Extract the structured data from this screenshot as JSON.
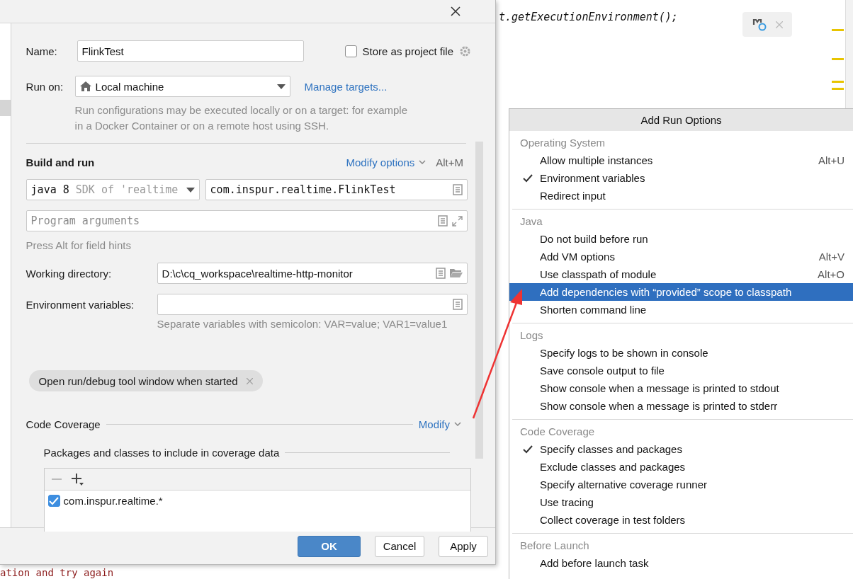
{
  "editor": {
    "code_line": "t.getExecutionEnvironment();",
    "console_line": "ation and try again"
  },
  "dialog": {
    "name": {
      "label": "Name:",
      "value": "FlinkTest"
    },
    "store_as_project_file": {
      "label": "Store as project file",
      "checked": false
    },
    "run_on": {
      "label": "Run on:",
      "value": "Local machine",
      "link": "Manage targets..."
    },
    "run_on_hint": "Run configurations may be executed locally or on a target: for example in a Docker Container or on a remote host using SSH.",
    "build_and_run": {
      "title": "Build and run",
      "modify_link": "Modify options",
      "shortcut": "Alt+M",
      "jdk": {
        "value": "java 8",
        "detail": "SDK of 'realtime"
      },
      "main_class": "com.inspur.realtime.FlinkTest",
      "program_arguments": {
        "placeholder": "Program arguments"
      },
      "field_hint": "Press Alt for field hints"
    },
    "working_directory": {
      "label": "Working directory:",
      "value": "D:\\c\\cq_workspace\\realtime-http-monitor"
    },
    "environment_variables": {
      "label": "Environment variables:",
      "hint": "Separate variables with semicolon: VAR=value; VAR1=value1"
    },
    "option_chip": "Open run/debug tool window when started",
    "code_coverage": {
      "title": "Code Coverage",
      "modify_link": "Modify",
      "include_title": "Packages and classes to include in coverage data",
      "patterns": [
        {
          "label": "com.inspur.realtime.*",
          "checked": true
        }
      ]
    },
    "buttons": [
      {
        "label": "OK",
        "kind": "primary"
      },
      {
        "label": "Cancel",
        "kind": "normal"
      },
      {
        "label": "Apply",
        "kind": "normal"
      }
    ]
  },
  "popup": {
    "title": "Add Run Options",
    "sections": [
      {
        "header": "Operating System",
        "items": [
          {
            "label": "Allow multiple instances",
            "checked": false,
            "selected": false,
            "shortcut": "Alt+U"
          },
          {
            "label": "Environment variables",
            "checked": true,
            "selected": false
          },
          {
            "label": "Redirect input",
            "checked": false,
            "selected": false
          }
        ]
      },
      {
        "header": "Java",
        "items": [
          {
            "label": "Do not build before run",
            "checked": false,
            "selected": false
          },
          {
            "label": "Add VM options",
            "checked": false,
            "selected": false,
            "shortcut": "Alt+V"
          },
          {
            "label": "Use classpath of module",
            "checked": false,
            "selected": false,
            "shortcut": "Alt+O"
          },
          {
            "label": "Add dependencies with “provided” scope to classpath",
            "checked": false,
            "selected": true
          },
          {
            "label": "Shorten command line",
            "checked": false,
            "selected": false
          }
        ]
      },
      {
        "header": "Logs",
        "items": [
          {
            "label": "Specify logs to be shown in console",
            "checked": false,
            "selected": false
          },
          {
            "label": "Save console output to file",
            "checked": false,
            "selected": false
          },
          {
            "label": "Show console when a message is printed to stdout",
            "checked": false,
            "selected": false
          },
          {
            "label": "Show console when a message is printed to stderr",
            "checked": false,
            "selected": false
          }
        ]
      },
      {
        "header": "Code Coverage",
        "items": [
          {
            "label": "Specify classes and packages",
            "checked": true,
            "selected": false
          },
          {
            "label": "Exclude classes and packages",
            "checked": false,
            "selected": false
          },
          {
            "label": "Specify alternative coverage runner",
            "checked": false,
            "selected": false
          },
          {
            "label": "Use tracing",
            "checked": false,
            "selected": false
          },
          {
            "label": "Collect coverage in test folders",
            "checked": false,
            "selected": false
          }
        ]
      },
      {
        "header": "Before Launch",
        "items": [
          {
            "label": "Add before launch task",
            "checked": false,
            "selected": false
          }
        ]
      }
    ]
  }
}
